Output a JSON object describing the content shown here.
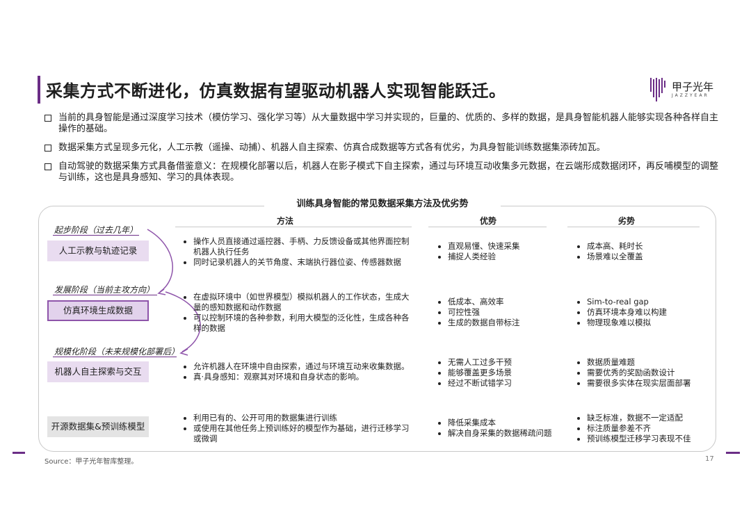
{
  "header": {
    "title": "采集方式不断进化，仿真数据有望驱动机器人实现智能跃迁。",
    "logo_text": "甲子光年",
    "logo_sub": "JAZZYEAR"
  },
  "bullets": [
    "当前的具身智能是通过深度学习技术（模仿学习、强化学习等）从大量数据中学习并实现的，巨量的、优质的、多样的数据，是具身智能机器人能够实现各种各样自主操作的基础。",
    "数据采集方式呈现多元化，人工示教（遥操、动捕）、机器人自主探索、仿真合成数据等方式各有优劣，为具身智能训练数据集添砖加瓦。",
    "自动驾驶的数据采集方式具备借鉴意义：在规模化部署以后，机器人在影子模式下自主探索，通过与环境互动收集多元数据，在云端形成数据闭环，再反哺模型的调整与训练，这也是具身感知、学习的具体表现。"
  ],
  "table": {
    "title": "训练具身智能的常见数据采集方法及优劣势",
    "headers": {
      "method": "方法",
      "pros": "优势",
      "cons": "劣势"
    },
    "stages": [
      "起步阶段（过去几年）",
      "发展阶段（当前主攻方向）",
      "规模化阶段（未来规模化部署后）"
    ],
    "rows": [
      {
        "category": "人工示教与轨迹记录",
        "method": [
          "操作人员直接通过遥控器、手柄、力反馈设备或其他界面控制机器人执行任务",
          "同时记录机器人的关节角度、末端执行器位姿、传感器数据"
        ],
        "pros": [
          "直观易懂、快速采集",
          "捕捉人类经验"
        ],
        "cons": [
          "成本高、耗时长",
          "场景难以全覆盖"
        ]
      },
      {
        "category": "仿真环境生成数据",
        "method": [
          "在虚拟环境中（如世界模型）模拟机器人的工作状态，生成大量的感知数据和动作数据",
          "可以控制环境的各种参数，利用大模型的泛化性，生成各种各样的数据"
        ],
        "pros": [
          "低成本、高效率",
          "可控性强",
          "生成的数据自带标注"
        ],
        "cons": [
          "Sim-to-real gap",
          "仿真环境本身难以构建",
          "物理现象难以模拟"
        ]
      },
      {
        "category": "机器人自主探索与交互",
        "method": [
          "允许机器人在环境中自由探索，通过与环境互动来收集数据。",
          "真·具身感知：观察其对环境和自身状态的影响。"
        ],
        "pros": [
          "无需人工过多干预",
          "能够覆盖更多场景",
          "经过不断试错学习"
        ],
        "cons": [
          "数据质量难题",
          "需要优秀的奖励函数设计",
          "需要很多实体在现实层面部署"
        ]
      },
      {
        "category": "开源数据集&预训练模型",
        "method": [
          "利用已有的、公开可用的数据集进行训练",
          "或使用在其他任务上预训练好的模型作为基础，进行迁移学习或微调"
        ],
        "pros": [
          "降低采集成本",
          "解决自身采集的数据稀疏问题"
        ],
        "cons": [
          "缺乏标准，数据不一定适配",
          "标注质量参差不齐",
          "预训练模型迁移学习表现不佳"
        ]
      }
    ]
  },
  "footer": {
    "source": "Source：甲子光年智库整理。",
    "page": "17"
  },
  "colors": {
    "accent": "#6b2d86",
    "category_bg": "#e9dcf0",
    "category_gray": "#e4e4e4"
  }
}
